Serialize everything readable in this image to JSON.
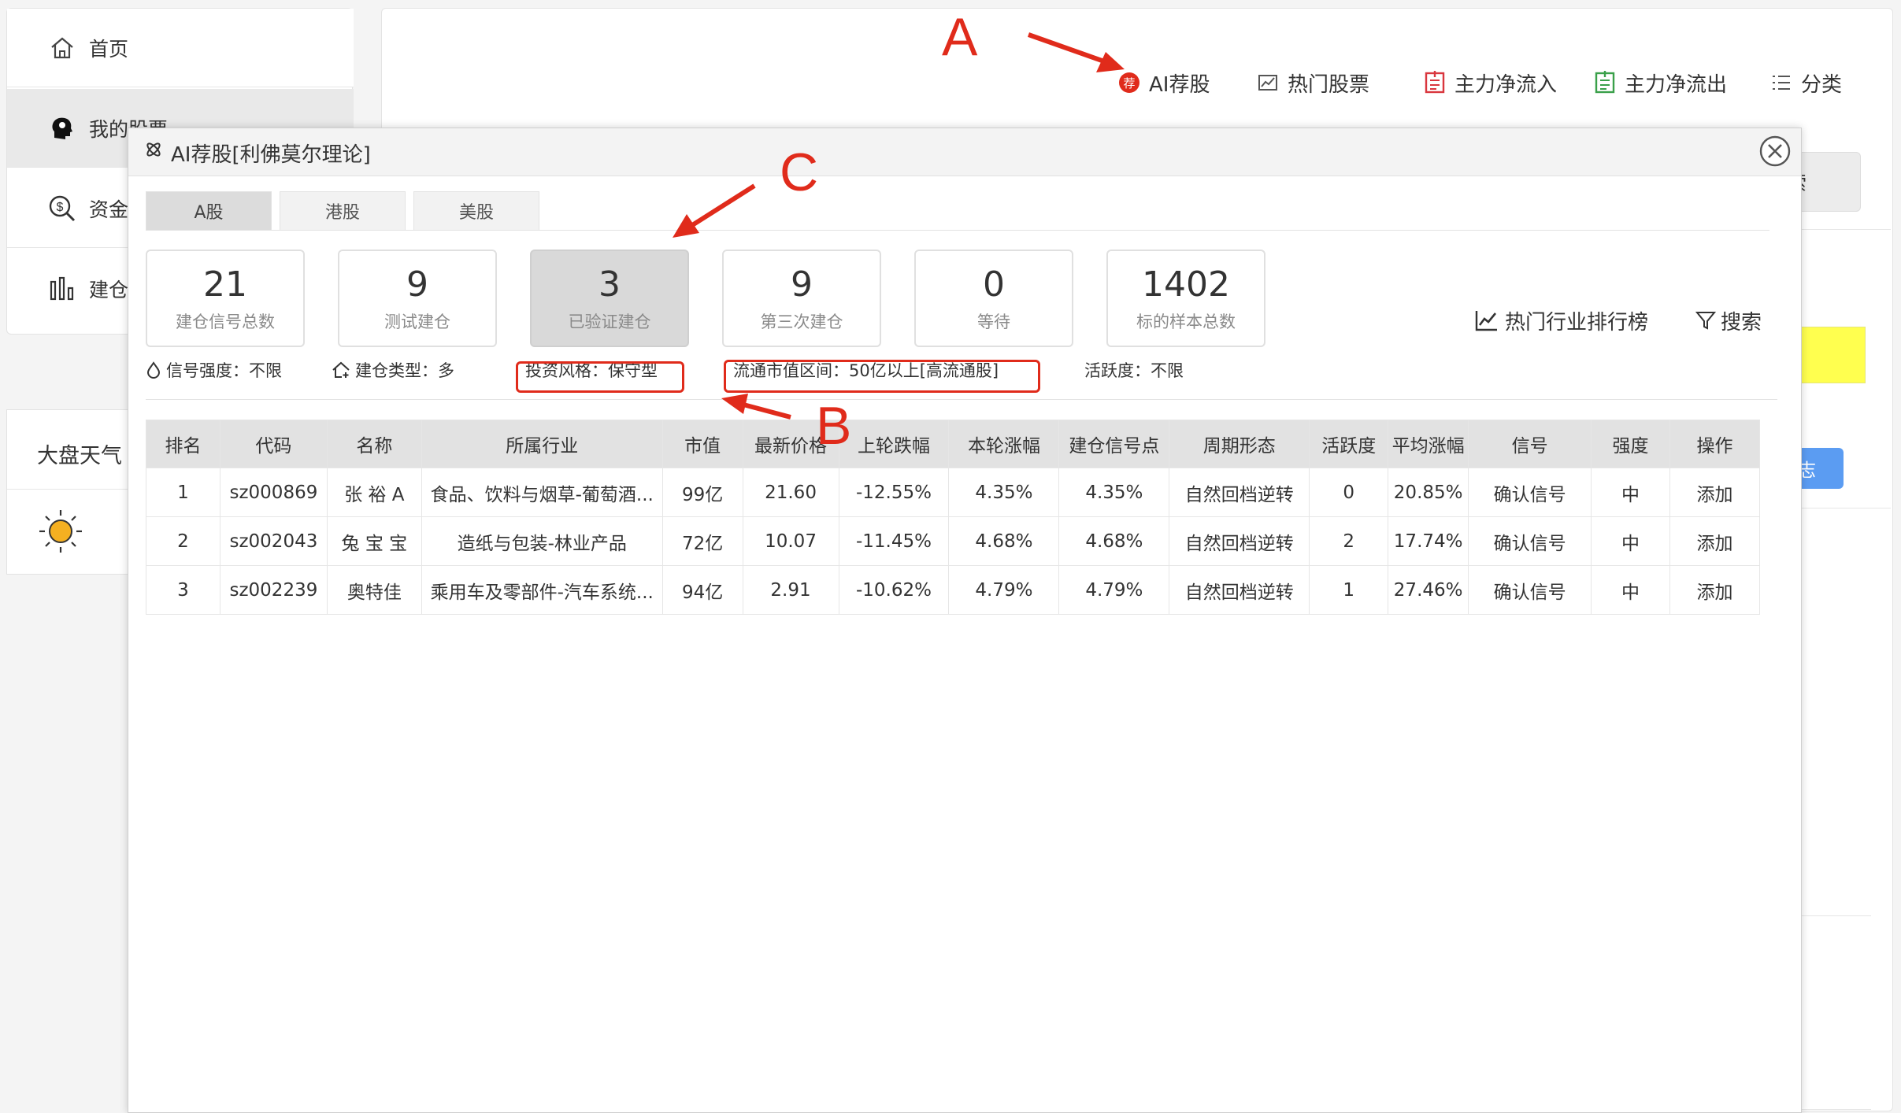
{
  "sidebar": {
    "items": [
      {
        "label": "首页",
        "icon": "home-icon"
      },
      {
        "label": "我的股票",
        "icon": "brain-head-icon"
      },
      {
        "label": "资金",
        "icon": "money-search-icon"
      },
      {
        "label": "建仓",
        "icon": "bar-chart-icon"
      }
    ],
    "weather_title": "大盘天气",
    "weather_icon": "sun-icon"
  },
  "nav": {
    "items": [
      {
        "label": "AI荐股",
        "icon": "ai-badge-icon",
        "icon_text": "荐"
      },
      {
        "label": "热门股票",
        "icon": "chart-icon"
      },
      {
        "label": "主力净流入",
        "icon": "inflow-icon"
      },
      {
        "label": "主力净流出",
        "icon": "outflow-icon"
      },
      {
        "label": "分类",
        "icon": "list-icon"
      }
    ]
  },
  "background": {
    "search_button": "搜索",
    "log_button": "日志"
  },
  "modal": {
    "title": "AI荐股[利佛莫尔理论]",
    "tabs": [
      "A股",
      "港股",
      "美股"
    ],
    "active_tab": 0,
    "stats": [
      {
        "value": "21",
        "label": "建仓信号总数"
      },
      {
        "value": "9",
        "label": "测试建仓"
      },
      {
        "value": "3",
        "label": "已验证建仓"
      },
      {
        "value": "9",
        "label": "第三次建仓"
      },
      {
        "value": "0",
        "label": "等待"
      },
      {
        "value": "1402",
        "label": "标的样本总数"
      }
    ],
    "active_stat": 2,
    "actions": {
      "rank_label": "热门行业排行榜",
      "search_label": "搜索"
    },
    "filters": {
      "signal_strength": "信号强度：不限",
      "position_type": "建仓类型：多",
      "invest_style": "投资风格：保守型",
      "market_cap_range": "流通市值区间：50亿以上[高流通股]",
      "activity": "活跃度：不限"
    },
    "table": {
      "columns": [
        "排名",
        "代码",
        "名称",
        "所属行业",
        "市值",
        "最新价格",
        "上轮跌幅",
        "本轮涨幅",
        "建仓信号点",
        "周期形态",
        "活跃度",
        "平均涨幅",
        "信号",
        "强度",
        "操作"
      ],
      "rows": [
        [
          "1",
          "sz000869",
          "张 裕 A",
          "食品、饮料与烟草-葡萄酒...",
          "99亿",
          "21.60",
          "-12.55%",
          "4.35%",
          "4.35%",
          "自然回档逆转",
          "0",
          "20.85%",
          "确认信号",
          "中",
          "添加"
        ],
        [
          "2",
          "sz002043",
          "兔 宝 宝",
          "造纸与包装-林业产品",
          "72亿",
          "10.07",
          "-11.45%",
          "4.68%",
          "4.68%",
          "自然回档逆转",
          "2",
          "17.74%",
          "确认信号",
          "中",
          "添加"
        ],
        [
          "3",
          "sz002239",
          "奥特佳",
          "乘用车及零部件-汽车系统...",
          "94亿",
          "2.91",
          "-10.62%",
          "4.79%",
          "4.79%",
          "自然回档逆转",
          "1",
          "27.46%",
          "确认信号",
          "中",
          "添加"
        ]
      ]
    }
  },
  "annotations": {
    "labels": [
      "A",
      "B",
      "C"
    ],
    "color": "#e02b1b"
  },
  "colors": {
    "accent_red": "#e02b1b",
    "nav_red": "#d9363e",
    "nav_green": "#3aa04a",
    "yellow_bar": "#ffff4f",
    "blue_button": "#5b9cf2"
  }
}
